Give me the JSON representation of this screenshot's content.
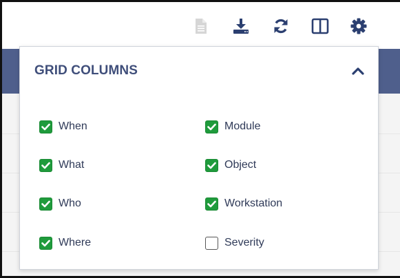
{
  "toolbar": {
    "buttons": [
      {
        "name": "document-icon",
        "color": "#d6d6d6"
      },
      {
        "name": "download-icon",
        "color": "#2b3f70"
      },
      {
        "name": "refresh-icon",
        "color": "#2b3f70"
      },
      {
        "name": "columns-layout-icon",
        "color": "#2b3f70"
      },
      {
        "name": "gear-icon",
        "color": "#2b3f70"
      }
    ]
  },
  "panel": {
    "title": "GRID COLUMNS",
    "collapse_icon": "chevron-up-icon",
    "columns": [
      {
        "label": "When",
        "checked": true
      },
      {
        "label": "What",
        "checked": true
      },
      {
        "label": "Who",
        "checked": true
      },
      {
        "label": "Where",
        "checked": true
      },
      {
        "label": "Module",
        "checked": true
      },
      {
        "label": "Object",
        "checked": true
      },
      {
        "label": "Workstation",
        "checked": true
      },
      {
        "label": "Severity",
        "checked": false
      }
    ]
  },
  "colors": {
    "accent": "#3f4e7a",
    "checked": "#1f9b3c",
    "header_band": "#4f5f8c"
  }
}
